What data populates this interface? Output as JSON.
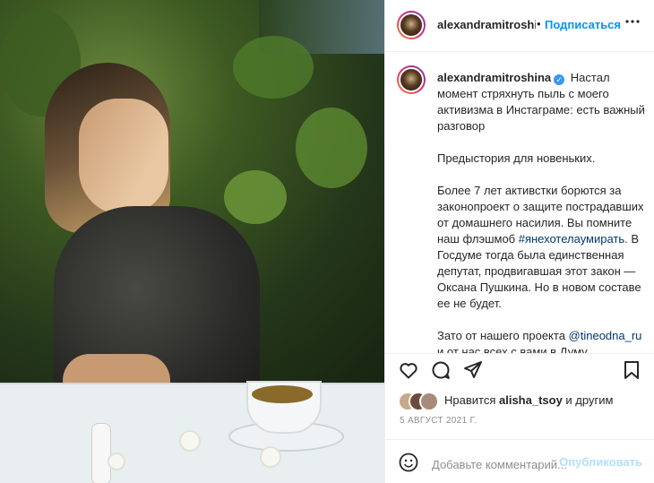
{
  "photo": {
    "alt": "",
    "accent": "#2b3a1a"
  },
  "header": {
    "username": "alexandramitroshina",
    "separator": "•",
    "follow_label": "Подписаться",
    "more_icon": "more-horizontal-icon"
  },
  "caption": {
    "username": "alexandramitroshina",
    "verified_icon": "verified-badge-icon",
    "lines": [
      "Настал момент стряхнуть пыль с моего активизма в Инстаграме: есть важный разговор",
      "Предыстория для новеньких.",
      "Более 7 лет активстки борются за законопроект о защите пострадавших от домашнего насилия. Вы помните наш флэшмоб #янехотелаумирать. В Госдуме тогда была единственная депутат, продвигавшая этот закон — Оксана Пушкина. Но в новом составе ее не будет.",
      "Зато от нашего проекта @tineodna_ru и от нас всех с вами в Думу выдвинулась (от партии Яблоко) моя подруга, юристка и соавторка"
    ],
    "p1": "Настал момент стряхнуть пыль с моего активизма в Инстаграме: есть важный разговор",
    "p2": "Предыстория для новеньких.",
    "p3_before": "Более 7 лет активстки борются за законопроект о защите пострадавших от домашнего насилия. Вы помните наш флэшмоб ",
    "p3_hashtag": "#янехотелаумирать",
    "p3_after": ". В Госдуме тогда была единственная депутат, продвигавшая этот закон — Оксана Пушкина. Но в новом составе ее не будет.",
    "p4_before": "Зато от нашего проекта ",
    "p4_mention": "@tineodna_ru",
    "p4_after": " и от нас всех с вами в Думу выдвинулась (от партии Яблоко) моя подруга, юристка и соавторка"
  },
  "actions": {
    "like_icon": "heart-icon",
    "comment_icon": "comment-icon",
    "share_icon": "share-icon",
    "save_icon": "bookmark-icon"
  },
  "likes": {
    "prefix": "Нравится ",
    "user": "alisha_tsoy",
    "suffix": " и другим"
  },
  "date": "5 АВГУСТ 2021 Г.",
  "comment": {
    "emoji_icon": "emoji-icon",
    "placeholder": "Добавьте комментарий...",
    "publish_label": "Опубликовать"
  },
  "colors": {
    "link": "#0095f6",
    "hashtag": "#00376b",
    "muted": "#8e8e8e",
    "verified": "#3897f0"
  }
}
